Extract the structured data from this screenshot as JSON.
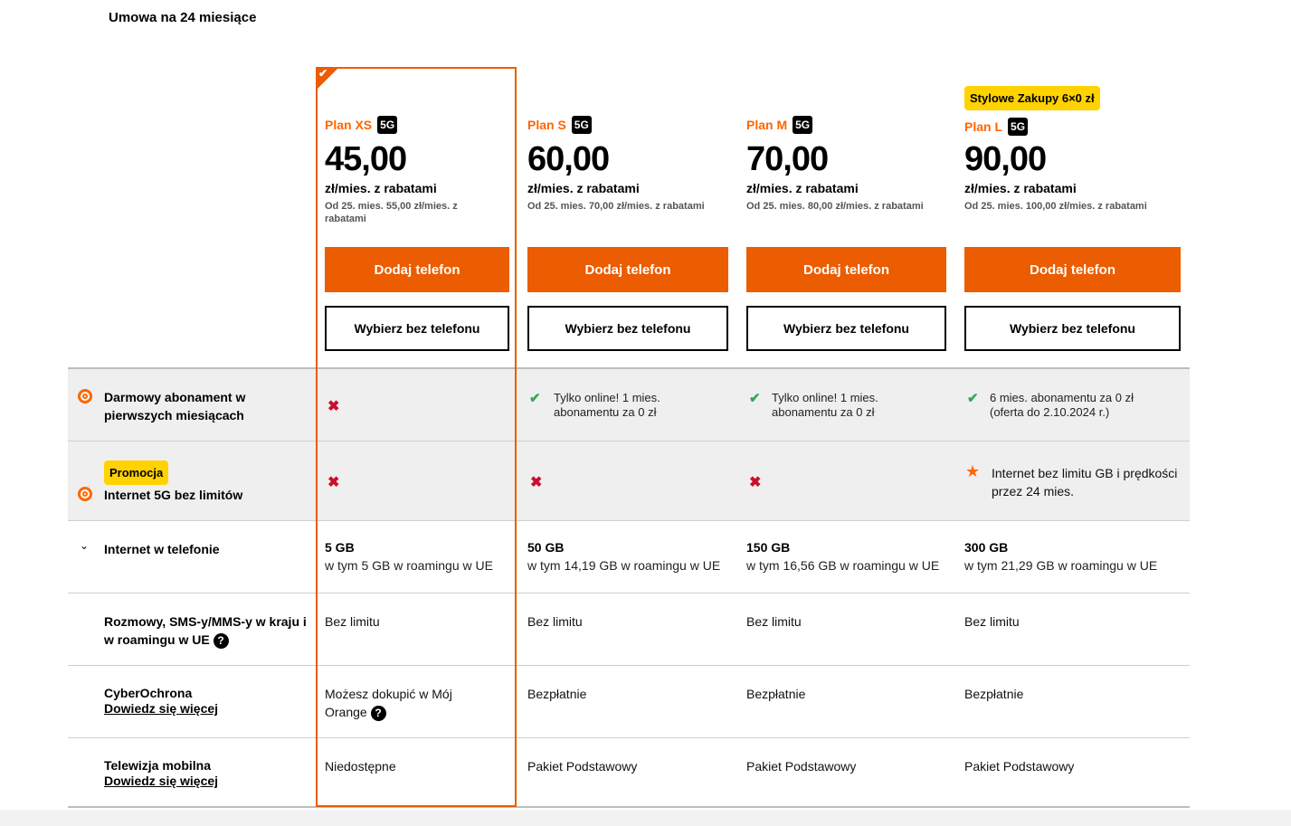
{
  "page": {
    "title": "Umowa na 24 miesiące"
  },
  "plans": [
    {
      "name": "Plan XS",
      "badge": "5G",
      "price": "45,00",
      "unit": "zł/mies. z rabatami",
      "note": "Od 25. mies. 55,00 zł/mies. z rabatami",
      "add_phone": "Dodaj telefon",
      "no_phone": "Wybierz bez telefonu",
      "selected": true
    },
    {
      "name": "Plan S",
      "badge": "5G",
      "price": "60,00",
      "unit": "zł/mies. z rabatami",
      "note": "Od 25. mies. 70,00 zł/mies. z rabatami",
      "add_phone": "Dodaj telefon",
      "no_phone": "Wybierz bez telefonu"
    },
    {
      "name": "Plan M",
      "badge": "5G",
      "price": "70,00",
      "unit": "zł/mies. z rabatami",
      "note": "Od 25. mies. 80,00 zł/mies. z rabatami",
      "add_phone": "Dodaj telefon",
      "no_phone": "Wybierz bez telefonu"
    },
    {
      "name": "Plan L",
      "badge": "5G",
      "promo": "Stylowe Zakupy 6×0 zł",
      "price": "90,00",
      "unit": "zł/mies. z rabatami",
      "note": "Od 25. mies. 100,00 zł/mies. z rabatami",
      "add_phone": "Dodaj telefon",
      "no_phone": "Wybierz bez telefonu"
    }
  ],
  "features": {
    "free_sub": {
      "label": "Darmowy abonament w pierwszych miesiącach",
      "icon": "orange-promo-icon",
      "values": [
        "",
        "Tylko online! 1 mies. abonamentu za 0 zł",
        "Tylko online! 1 mies. abonamentu za 0 zł",
        "6 mies. abonamentu za 0 zł (oferta do 2.10.2024 r.)"
      ]
    },
    "internet_5g": {
      "promo": "Promocja",
      "label": "Internet 5G bez limitów",
      "values": [
        "",
        "",
        "",
        "Internet bez limitu GB i prędkości przez 24 mies."
      ]
    },
    "internet_phone": {
      "label": "Internet w telefonie",
      "values": [
        {
          "main": "5 GB",
          "sub": "w tym 5 GB w roamingu w UE"
        },
        {
          "main": "50 GB",
          "sub": "w tym 14,19 GB w roamingu w UE"
        },
        {
          "main": "150 GB",
          "sub": "w tym 16,56 GB w roamingu w UE"
        },
        {
          "main": "300 GB",
          "sub": "w tym 21,29 GB w roamingu w UE"
        }
      ]
    },
    "calls": {
      "label": "Rozmowy, SMS-y/MMS-y w kraju i w roamingu w UE",
      "values": [
        "Bez limitu",
        "Bez limitu",
        "Bez limitu",
        "Bez limitu"
      ]
    },
    "cyber": {
      "label": "CyberOchrona",
      "link": "Dowiedz się więcej",
      "values": [
        "Możesz dokupić w Mój Orange",
        "Bezpłatnie",
        "Bezpłatnie",
        "Bezpłatnie"
      ]
    },
    "tv": {
      "label": "Telewizja mobilna",
      "link": "Dowiedz się więcej",
      "values": [
        "Niedostępne",
        "Pakiet Podstawowy",
        "Pakiet Podstawowy",
        "Pakiet Podstawowy"
      ]
    }
  },
  "icons": {
    "cross": "✖",
    "check": "✔",
    "star": "★",
    "help": "?",
    "chevron": "⌄",
    "corner_check": "✔"
  },
  "colors": {
    "accent": "#ec5c00",
    "promo": "#ffd200",
    "cross": "#c8102e",
    "check": "#32a853"
  }
}
